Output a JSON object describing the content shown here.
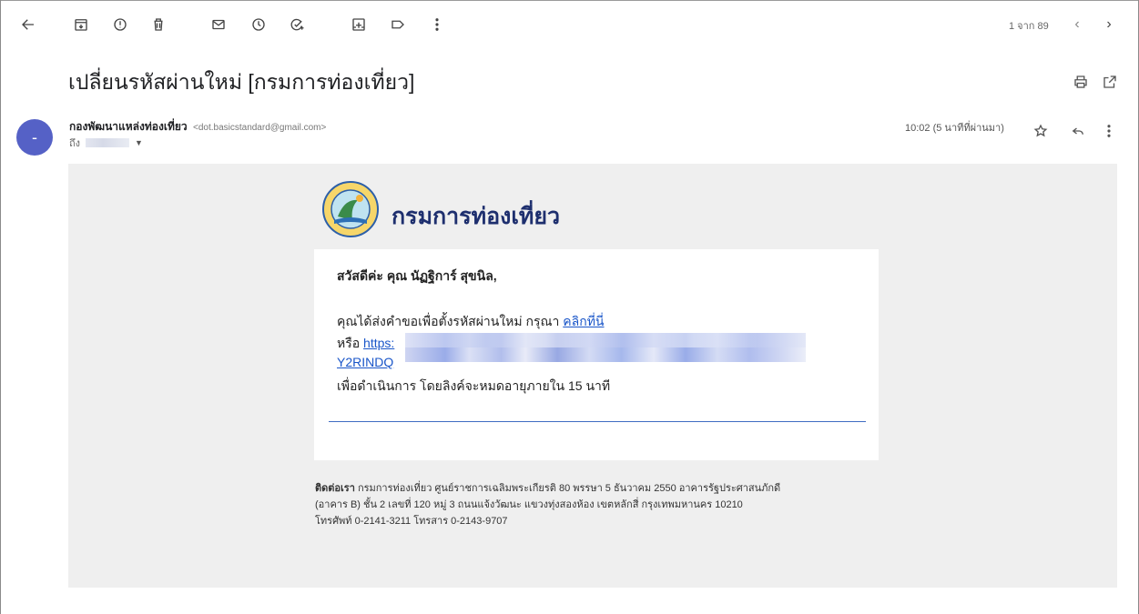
{
  "toolbar": {
    "back": "arrow-left-icon",
    "items": [
      "archive-icon",
      "report-spam-icon",
      "delete-icon",
      "mark-unread-icon",
      "snooze-icon",
      "add-task-icon",
      "move-to-icon",
      "label-icon",
      "more-vert-icon"
    ]
  },
  "pager": {
    "text": "1 จาก 89"
  },
  "email": {
    "subject": "เปลี่ยนรหัสผ่านใหม่ [กรมการท่องเที่ยว]",
    "avatar_letter": "-",
    "sender_name": "กองพัฒนาแหล่งท่องเที่ยว",
    "sender_email": "<dot.basicstandard@gmail.com>",
    "to_label": "ถึง",
    "timestamp": "10:02 (5 นาทีที่ผ่านมา)"
  },
  "body": {
    "org_name": "กรมการท่องเที่ยว",
    "greeting": "สวัสดีค่ะ คุณ นัฏฐิการ์ สุขนิล,",
    "line1_text": "คุณได้ส่งคำขอเพื่อตั้งรหัสผ่านใหม่ กรุณา ",
    "line1_link": "คลิกที่นี่",
    "line2_text": "หรือ ",
    "line2_link": "https:",
    "line3_link": "Y2RINDQ",
    "line4_text": "เพื่อดำเนินการ โดยลิงค์จะหมดอายุภายใน 15 นาที",
    "footer_bold": "ติดต่อเรา",
    "footer_line1": " กรมการท่องเที่ยว ศูนย์ราชการเฉลิมพระเกียรติ 80 พรรษา 5 ธันวาคม 2550 อาคารรัฐประศาสนภักดี",
    "footer_line2": "(อาคาร B) ชั้น 2 เลขที่ 120 หมู่ 3 ถนนแจ้งวัฒนะ แขวงทุ่งสองห้อง เขตหลักสี่ กรุงเทพมหานคร 10210",
    "footer_line3": "โทรศัพท์ 0-2141-3211 โทรสาร 0-2143-9707"
  },
  "colors": {
    "avatar": "#5561c6",
    "link": "#1a56c9",
    "logo_text": "#1e2f6e",
    "body_bg": "#efefef"
  }
}
